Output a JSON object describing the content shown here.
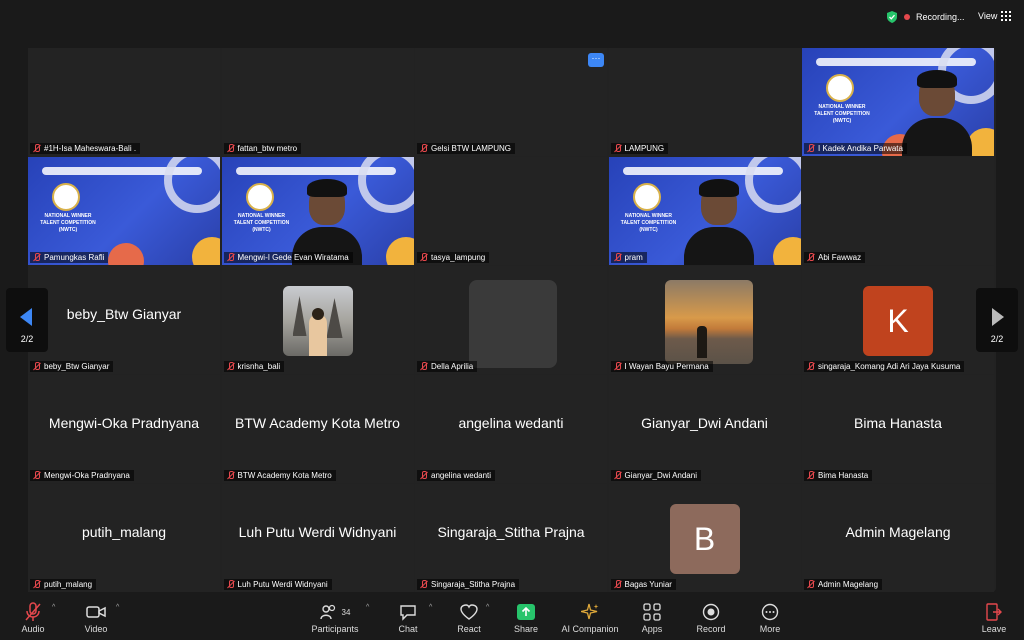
{
  "topbar": {
    "recording_label": "Recording...",
    "view_label": "View"
  },
  "pager": {
    "page": "2/2"
  },
  "more_label": "···",
  "tiles": [
    {
      "name": "#1H-Isa Maheswara-Bali ."
    },
    {
      "name": "fattan_btw metro"
    },
    {
      "name": "Gelsi BTW LAMPUNG"
    },
    {
      "name": "LAMPUNG"
    },
    {
      "name": "I Kadek Andika Parwata"
    },
    {
      "name": "Pamungkas Rafli"
    },
    {
      "name": "Mengwi-I Gede Evan Wiratama"
    },
    {
      "name": "tasya_lampung"
    },
    {
      "name": "pram"
    },
    {
      "name": "Abi Fawwaz"
    },
    {
      "name": "beby_Btw Gianyar",
      "center": "beby_Btw Gianyar"
    },
    {
      "name": "krisnha_bali"
    },
    {
      "name": "Della Aprilia"
    },
    {
      "name": "I Wayan Bayu Permana"
    },
    {
      "name": "singaraja_Komang Adi Ari Jaya Kusuma",
      "letter": "K"
    },
    {
      "name": "Mengwi-Oka Pradnyana",
      "center": "Mengwi-Oka Pradnyana"
    },
    {
      "name": "BTW Academy Kota Metro",
      "center": "BTW Academy Kota Metro"
    },
    {
      "name": "angelina wedanti",
      "center": "angelina wedanti"
    },
    {
      "name": "Gianyar_Dwi Andani",
      "center": "Gianyar_Dwi Andani"
    },
    {
      "name": "Bima Hanasta",
      "center": "Bima Hanasta"
    },
    {
      "name": "putih_malang",
      "center": "putih_malang"
    },
    {
      "name": "Luh Putu Werdi Widnyani",
      "center": "Luh Putu Werdi Widnyani"
    },
    {
      "name": "Singaraja_Stitha Prajna",
      "center": "Singaraja_Stitha Prajna"
    },
    {
      "name": "Bagas Yuniar",
      "letter": "B"
    },
    {
      "name": "Admin Magelang",
      "center": "Admin Magelang"
    }
  ],
  "banner_text": "NATIONAL WINNER TALENT COMPETITION (NWTC)",
  "toolbar": {
    "audio": "Audio",
    "video": "Video",
    "participants": "Participants",
    "participants_count": "34",
    "chat": "Chat",
    "react": "React",
    "share": "Share",
    "ai": "AI Companion",
    "apps": "Apps",
    "record": "Record",
    "more": "More",
    "leave": "Leave"
  },
  "colors": {
    "accent": "#3d87f5",
    "share": "#27c46b",
    "k_avatar": "#c0431e",
    "b_avatar": "#8d6a5c",
    "muted": "#e5484d"
  }
}
